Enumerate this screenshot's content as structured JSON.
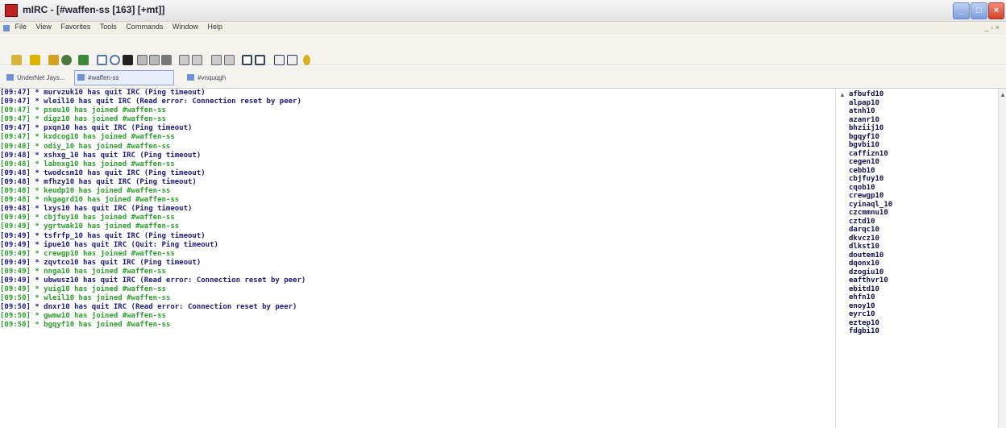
{
  "window": {
    "title": "mIRC - [#waffen-ss [163] [+mt]]"
  },
  "menu": [
    "File",
    "View",
    "Favorites",
    "Tools",
    "Commands",
    "Window",
    "Help"
  ],
  "switchbar": {
    "tabs": [
      {
        "label": "UnderNet Jays...",
        "active": false
      },
      {
        "label": "#waffen-ss",
        "active": true
      },
      {
        "label": "#vnquqgh",
        "active": false
      }
    ]
  },
  "chat": {
    "lines": [
      {
        "text": "[09:47] * murvzuk10 has quit IRC (Ping timeout)",
        "kind": "quit"
      },
      {
        "text": "[09:47] * wleil10 has quit IRC (Read error: Connection reset by peer)",
        "kind": "quit"
      },
      {
        "text": "[09:47] * pseu10 has joined #waffen-ss",
        "kind": "join"
      },
      {
        "text": "[09:47] * digz10 has joined #waffen-ss",
        "kind": "join"
      },
      {
        "text": "[09:47] * pxqn10 has quit IRC (Ping timeout)",
        "kind": "quit"
      },
      {
        "text": "[09:47] * kxdcog10 has joined #waffen-ss",
        "kind": "join"
      },
      {
        "text": "[09:48] * odiy_10 has joined #waffen-ss",
        "kind": "join"
      },
      {
        "text": "[09:48] * xshxg_10 has quit IRC (Ping timeout)",
        "kind": "quit"
      },
      {
        "text": "[09:48] * labnxg10 has joined #waffen-ss",
        "kind": "join"
      },
      {
        "text": "[09:48] * twodcsm10 has quit IRC (Ping timeout)",
        "kind": "quit"
      },
      {
        "text": "[09:48] * mfhzy10 has quit IRC (Ping timeout)",
        "kind": "quit"
      },
      {
        "text": "[09:48] * keudp10 has joined #waffen-ss",
        "kind": "join"
      },
      {
        "text": "[09:48] * nkgagrd10 has joined #waffen-ss",
        "kind": "join"
      },
      {
        "text": "[09:48] * lxys10 has quit IRC (Ping timeout)",
        "kind": "quit"
      },
      {
        "text": "[09:49] * cbjfuy10 has joined #waffen-ss",
        "kind": "join"
      },
      {
        "text": "[09:49] * ygrtwak10 has joined #waffen-ss",
        "kind": "join"
      },
      {
        "text": "[09:49] * tsfrfp_10 has quit IRC (Ping timeout)",
        "kind": "quit"
      },
      {
        "text": "[09:49] * ipue10 has quit IRC (Quit: Ping timeout)",
        "kind": "quit"
      },
      {
        "text": "[09:49] * crewgp10 has joined #waffen-ss",
        "kind": "join"
      },
      {
        "text": "[09:49] * zqvtco10 has quit IRC (Ping timeout)",
        "kind": "quit"
      },
      {
        "text": "[09:49] * nnga10 has joined #waffen-ss",
        "kind": "join"
      },
      {
        "text": "[09:49] * ubwusz10 has quit IRC (Read error: Connection reset by peer)",
        "kind": "quit"
      },
      {
        "text": "[09:49] * yuig10 has joined #waffen-ss",
        "kind": "join"
      },
      {
        "text": "[09:50] * wleil10 has joined #waffen-ss",
        "kind": "join"
      },
      {
        "text": "[09:50] * dnxr10 has quit IRC (Read error: Connection reset by peer)",
        "kind": "quit"
      },
      {
        "text": "[09:50] * gwmw10 has joined #waffen-ss",
        "kind": "join"
      },
      {
        "text": "[09:50] * bgqyf10 has joined #waffen-ss",
        "kind": "join"
      }
    ]
  },
  "nicklist": [
    "afbufd10",
    "alpap10",
    "atnh10",
    "azanr10",
    "bhziij10",
    "bgqyf10",
    "bgvbi10",
    "caffizn10",
    "cegen10",
    "cebb10",
    "cbjfuy10",
    "cqob10",
    "crewgp10",
    "cyinaql_10",
    "czcmmnu10",
    "cztd10",
    "darqc10",
    "dkvcz10",
    "dlkst10",
    "doutem10",
    "dqonx10",
    "dzogiu10",
    "eafthvr10",
    "ebitd10",
    "ehfn10",
    "enoy10",
    "eyrc10",
    "eztep10",
    "fdgbi10"
  ]
}
